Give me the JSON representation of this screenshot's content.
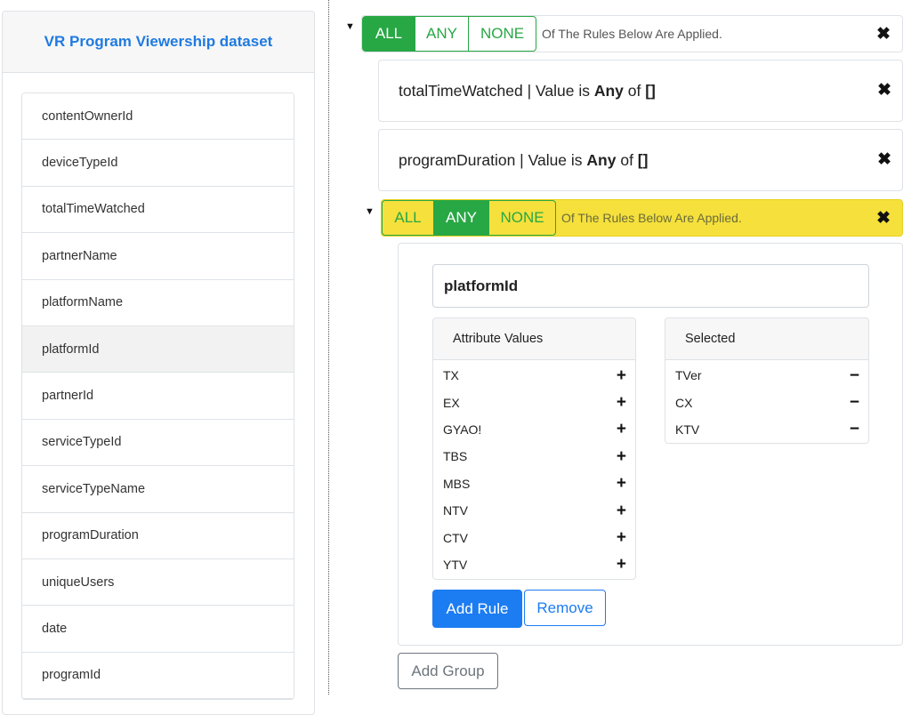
{
  "sidebar": {
    "title": "VR Program Viewership dataset",
    "fields": [
      {
        "label": "contentOwnerId"
      },
      {
        "label": "deviceTypeId"
      },
      {
        "label": "totalTimeWatched"
      },
      {
        "label": "partnerName"
      },
      {
        "label": "platformName"
      },
      {
        "label": "platformId",
        "active": true
      },
      {
        "label": "partnerId"
      },
      {
        "label": "serviceTypeId"
      },
      {
        "label": "serviceTypeName"
      },
      {
        "label": "programDuration"
      },
      {
        "label": "uniqueUsers"
      },
      {
        "label": "date"
      },
      {
        "label": "programId"
      }
    ]
  },
  "root_group": {
    "caret": "▼",
    "all_label": "ALL",
    "any_label": "ANY",
    "none_label": "NONE",
    "selected": "ALL",
    "description": "Of The Rules Below Are Applied.",
    "close_icon": "✖"
  },
  "rules": [
    {
      "field": "totalTimeWatched",
      "sep": " | Value is ",
      "op": "Any",
      "of": " of ",
      "value": "[]"
    },
    {
      "field": "programDuration",
      "sep": " | Value is ",
      "op": "Any",
      "of": " of ",
      "value": "[]"
    }
  ],
  "sub_group": {
    "caret": "▼",
    "all_label": "ALL",
    "any_label": "ANY",
    "none_label": "NONE",
    "selected": "ANY",
    "description": "Of The Rules Below Are Applied.",
    "close_icon": "✖",
    "highlight_color": "#f5e03c"
  },
  "editor": {
    "attribute": "platformId",
    "attribute_values_header": "Attribute Values",
    "selected_header": "Selected",
    "attribute_values": [
      "TX",
      "EX",
      "GYAO!",
      "TBS",
      "MBS",
      "NTV",
      "CTV",
      "YTV"
    ],
    "selected_values": [
      "TVer",
      "CX",
      "KTV"
    ],
    "add_icon": "+",
    "remove_icon": "−",
    "add_rule_label": "Add Rule",
    "remove_label": "Remove"
  },
  "add_group_label": "Add Group",
  "colors": {
    "accent_blue": "#1c7cf2",
    "success_green": "#28a745"
  }
}
